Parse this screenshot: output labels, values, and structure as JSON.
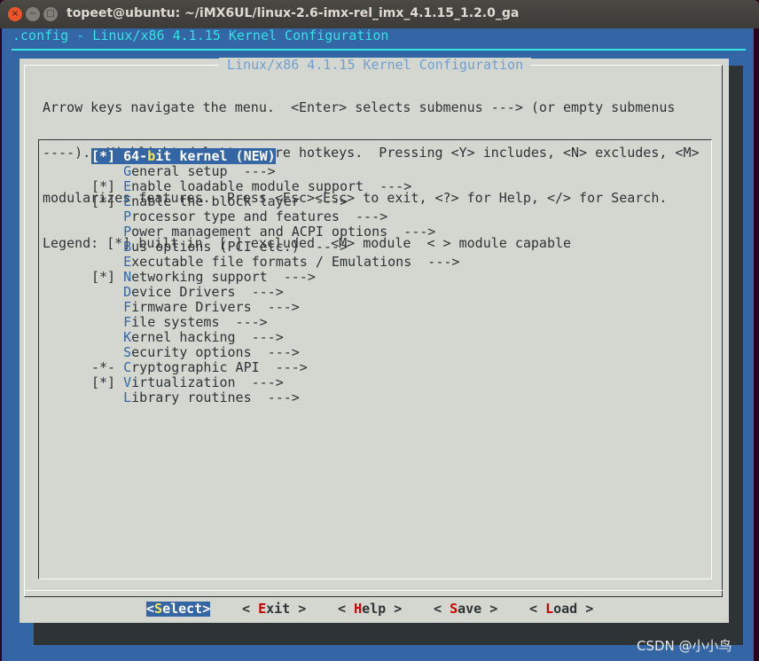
{
  "window": {
    "title": "topeet@ubuntu: ~/iMX6UL/linux-2.6-imx-rel_imx_4.1.15_1.2.0_ga",
    "close": "×",
    "minimize": "−",
    "maximize": "□"
  },
  "header": ".config - Linux/x86 4.1.15 Kernel Configuration",
  "dialog": {
    "title": "Linux/x86 4.1.15 Kernel Configuration",
    "help": [
      "Arrow keys navigate the menu.  <Enter> selects submenus ---> (or empty submenus",
      "----).  Highlighted letters are hotkeys.  Pressing <Y> includes, <N> excludes, <M>",
      "modularizes features.  Press <Esc><Esc> to exit, <?> for Help, </> for Search.",
      "Legend: [*] built-in  [ ] excluded  <M> module  < > module capable"
    ]
  },
  "menu": [
    {
      "prefix": "[*] ",
      "pre": "64-",
      "hot": "b",
      "post": "it kernel (NEW)",
      "selected": true
    },
    {
      "prefix": "    ",
      "pre": "",
      "hot": "G",
      "post": "eneral setup  --->"
    },
    {
      "prefix": "[*] ",
      "pre": "",
      "hot": "E",
      "post": "nable loadable module support  --->"
    },
    {
      "prefix": "[*] ",
      "pre": "",
      "hot": "E",
      "post": "nable the block layer  --->"
    },
    {
      "prefix": "    ",
      "pre": "",
      "hot": "P",
      "post": "rocessor type and features  --->"
    },
    {
      "prefix": "    ",
      "pre": "",
      "hot": "P",
      "post": "ower management and ACPI options  --->"
    },
    {
      "prefix": "    ",
      "pre": "",
      "hot": "B",
      "post": "us options (PCI etc.)  --->"
    },
    {
      "prefix": "    ",
      "pre": "",
      "hot": "E",
      "post": "xecutable file formats / Emulations  --->"
    },
    {
      "prefix": "[*] ",
      "pre": "",
      "hot": "N",
      "post": "etworking support  --->"
    },
    {
      "prefix": "    ",
      "pre": "",
      "hot": "D",
      "post": "evice Drivers  --->"
    },
    {
      "prefix": "    ",
      "pre": "",
      "hot": "F",
      "post": "irmware Drivers  --->"
    },
    {
      "prefix": "    ",
      "pre": "",
      "hot": "F",
      "post": "ile systems  --->"
    },
    {
      "prefix": "    ",
      "pre": "",
      "hot": "K",
      "post": "ernel hacking  --->"
    },
    {
      "prefix": "    ",
      "pre": "",
      "hot": "S",
      "post": "ecurity options  --->"
    },
    {
      "prefix": "-*- ",
      "pre": "",
      "hot": "C",
      "post": "ryptographic API  --->"
    },
    {
      "prefix": "[*] ",
      "pre": "",
      "hot": "V",
      "post": "irtualization  --->"
    },
    {
      "prefix": "    ",
      "pre": "",
      "hot": "L",
      "post": "ibrary routines  --->"
    }
  ],
  "buttons": [
    {
      "pre": "<",
      "hot": "S",
      "post": "elect>",
      "active": true
    },
    {
      "pre": "< ",
      "hot": "E",
      "post": "xit >"
    },
    {
      "pre": "< ",
      "hot": "H",
      "post": "elp >"
    },
    {
      "pre": "< ",
      "hot": "S",
      "post": "ave >"
    },
    {
      "pre": "< ",
      "hot": "L",
      "post": "oad >"
    }
  ],
  "watermark": "CSDN @小小鸟",
  "colors": {
    "terminal_bg": "#3465a4",
    "dialog_bg": "#d3d7cf",
    "header": "#34e2e2",
    "hotkey": "#3465a4",
    "button_hotkey": "#cc0000",
    "selected_hotkey": "#fce94f"
  }
}
